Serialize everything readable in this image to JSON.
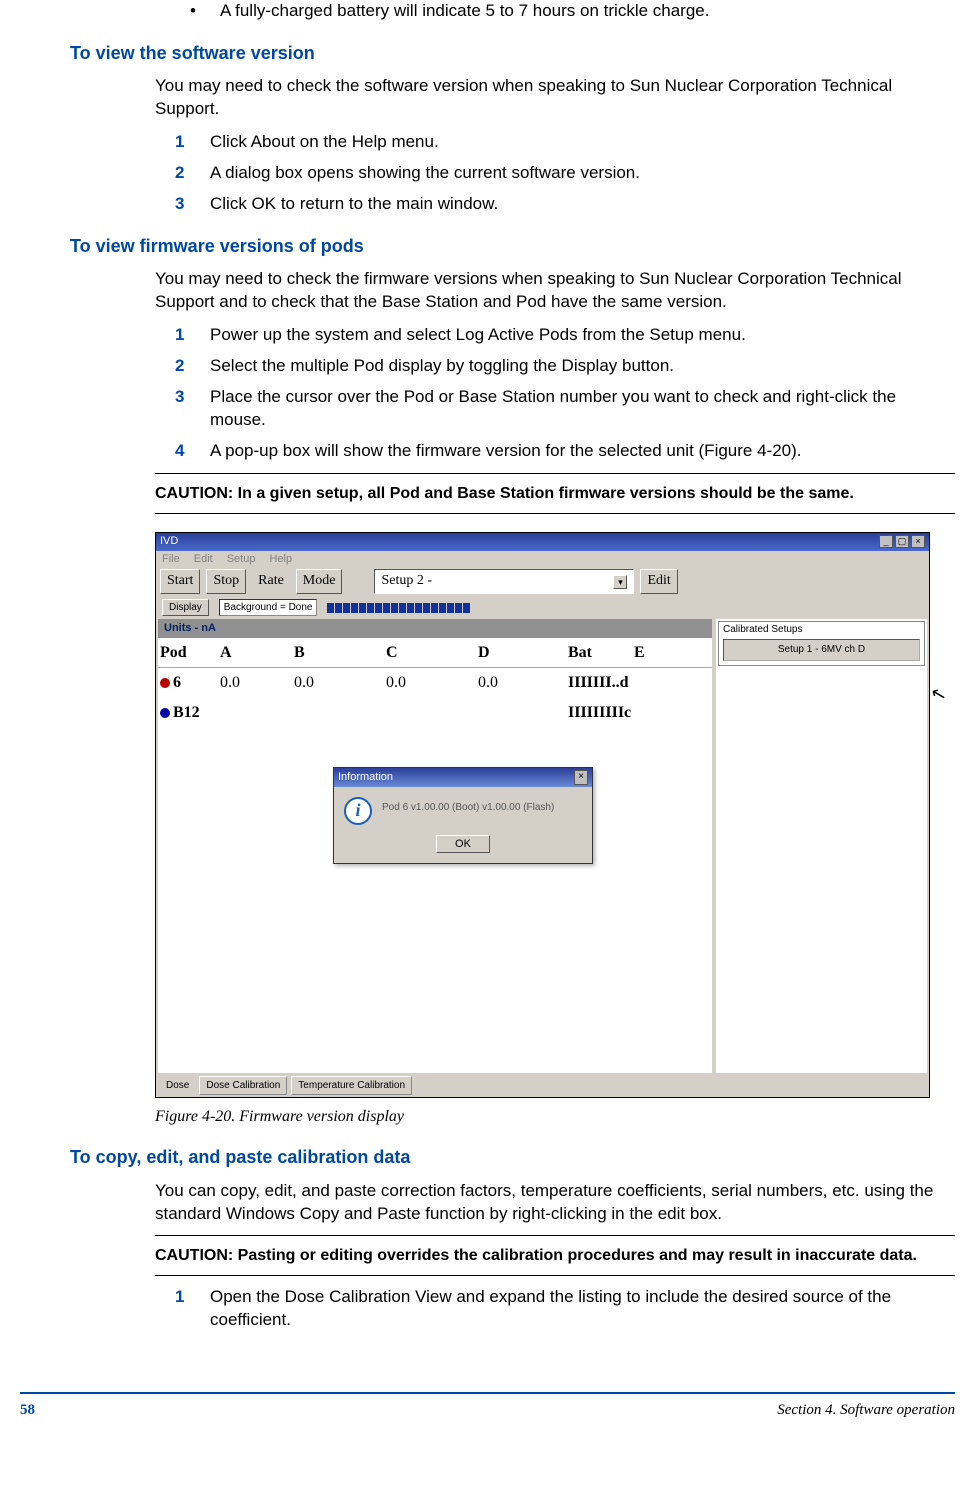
{
  "bullet1": "A fully-charged battery will indicate 5 to 7 hours on trickle charge.",
  "h1": "To view the software version",
  "p1": "You may need to check the software version when speaking to Sun Nuclear Corporation Technical Support.",
  "list1": {
    "n1": "1",
    "t1": "Click About on the Help menu.",
    "n2": "2",
    "t2": "A dialog box opens showing the current software version.",
    "n3": "3",
    "t3": "Click OK to return to the main window."
  },
  "h2": "To view firmware versions of pods",
  "p2": "You may need to check the firmware versions when speaking to Sun Nuclear Corporation Technical Support and to check that the Base Station and Pod have the same version.",
  "list2": {
    "n1": "1",
    "t1": "Power up the system and select Log Active Pods from the Setup menu.",
    "n2": "2",
    "t2": "Select the multiple Pod display by toggling the Display button.",
    "n3": "3",
    "t3": "Place the cursor over the Pod or Base Station number you want to check and right-click the mouse.",
    "n4": "4",
    "t4": "A pop-up box will show the firmware version for the selected unit (Figure 4-20)."
  },
  "caution1": "CAUTION: In a given setup, all Pod and Base Station firmware versions should be the same.",
  "sshot": {
    "title": "IVD",
    "menus": {
      "file": "File",
      "edit": "Edit",
      "setup": "Setup",
      "help": "Help"
    },
    "toolbar": {
      "start": "Start",
      "stop": "Stop",
      "rate": "Rate",
      "mode": "Mode",
      "setup_combo": "Setup 2 -",
      "editbtn": "Edit"
    },
    "strip": {
      "display": "Display",
      "bg": "Background = Done"
    },
    "units": "Units - nA",
    "cols": {
      "pod": "Pod",
      "a": "A",
      "b": "B",
      "c": "C",
      "d": "D",
      "bat": "Bat",
      "e": "E"
    },
    "row1": {
      "pod": "6",
      "a": "0.0",
      "b": "0.0",
      "c": "0.0",
      "d": "0.0",
      "bat": "IIIIIII..d"
    },
    "row2": {
      "pod": "B12",
      "bat": "IIIIIIIIIc"
    },
    "dialog": {
      "title": "Information",
      "msg": "Pod 6 v1.00.00 (Boot) v1.00.00 (Flash)",
      "ok": "OK"
    },
    "cal": {
      "title": "Calibrated Setups",
      "item": "Setup 1 - 6MV ch D"
    },
    "tabs": {
      "dose": "Dose",
      "dcal": "Dose Calibration",
      "tcal": "Temperature Calibration"
    }
  },
  "figcap": "Figure 4-20. Firmware version display",
  "h3": "To copy, edit, and paste calibration data",
  "p3": "You can copy, edit, and paste correction factors, temperature coefficients, serial numbers, etc. using the standard Windows Copy and Paste function by right-clicking in the edit box.",
  "caution2": "CAUTION: Pasting or editing overrides the calibration procedures and may result in inaccurate data.",
  "list3": {
    "n1": "1",
    "t1": "Open the Dose Calibration View and expand the listing to include the desired source of the coefficient."
  },
  "footer": {
    "page": "58",
    "section": "Section 4. Software operation"
  }
}
